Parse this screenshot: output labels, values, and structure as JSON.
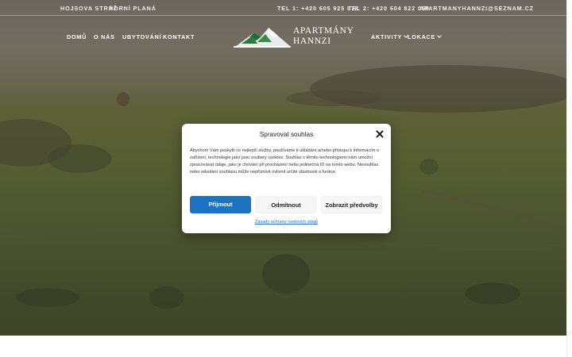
{
  "topbar": {
    "locations": [
      "HOJSOVA STRÁŽ",
      "HORNÍ PLANÁ"
    ],
    "contacts": [
      "TEL 1: +420 605 925 078",
      "TEL 2: +420 604 822 050",
      "APARTMANYHANNZI@SEZNAM.CZ"
    ]
  },
  "nav": {
    "left": [
      "DOMŮ",
      "O NÁS",
      "UBYTOVÁNÍ",
      "KONTAKT"
    ],
    "right": [
      "AKTIVITY",
      "LOKACE"
    ]
  },
  "logo": {
    "line1": "APARTMÁNY",
    "line2": "HANNZI"
  },
  "consent": {
    "title": "Spravovat souhlas",
    "body": "Abychom Vám poskytli co nejlepší služby, používáme k ukládání a/nebo přístupu k informacím o zařízení, technologie jako jsou soubory cookies. Souhlas s těmito technologiemi nám umožní zpracovávat údaje, jako je chování při procházení nebo jedinečná ID na tomto webu. Nesouhlas nebo odvolání souhlasu může nepříznivě ovlivnit určité vlastnosti a funkce.",
    "accept_label": "Přijmout",
    "deny_label": "Odmítnout",
    "preferences_label": "Zobrazit předvolby",
    "policy_link": "Zásady ochrany osobních údajů"
  },
  "colors": {
    "accent": "#1e73be",
    "overlay": "#2d2d2d"
  }
}
